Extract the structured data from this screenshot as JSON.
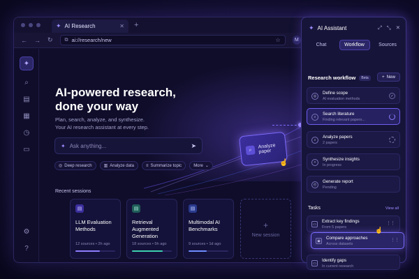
{
  "browser": {
    "tab_title": "AI Research",
    "url": "ai://research/new",
    "profile_initial": "M"
  },
  "hero": {
    "title_line1": "AI-powered research,",
    "title_line2": "done your way",
    "subtitle_line1": "Plan, search, analyze, and synthesize.",
    "subtitle_line2": "Your AI research assistant at every step.",
    "ask_placeholder": "Ask anything...",
    "chips": [
      "Deep research",
      "Analyze data",
      "Summarize topic",
      "More"
    ]
  },
  "floating_card": {
    "label_line1": "Analyze",
    "label_line2": "paper"
  },
  "recent": {
    "title": "Recent sessions",
    "sessions": [
      {
        "title_line1": "LLM Evaluation",
        "title_line2": "Methods",
        "meta": "12 sources • 2h ago",
        "progress": 0.62,
        "color": "#8e7dff"
      },
      {
        "title_line1": "Retrieval Augmented",
        "title_line2": "Generation",
        "meta": "18 sources • 5h ago",
        "progress": 0.78,
        "color": "#3fd1b0"
      },
      {
        "title_line1": "Multimodal AI",
        "title_line2": "Benchmarks",
        "meta": "9 sources • 1d ago",
        "progress": 0.45,
        "color": "#6f8dff"
      }
    ],
    "new_session_label": "New session"
  },
  "assistant": {
    "title": "AI Assistant",
    "tabs": [
      "Chat",
      "Workflow",
      "Sources"
    ],
    "selected_tab": "Workflow",
    "workflow_title": "Research workflow",
    "beta_label": "Beta",
    "new_label": "New",
    "steps": [
      {
        "title": "Define scope",
        "desc": "AI evaluation methods",
        "status": "done"
      },
      {
        "title": "Search literature",
        "desc": "Finding relevant papers...",
        "status": "in-progress"
      },
      {
        "title": "Analyze papers",
        "desc": "2 papers",
        "status": "running"
      },
      {
        "title": "Synthesize insights",
        "desc": "In progress",
        "status": "pending"
      },
      {
        "title": "Generate report",
        "desc": "Pending",
        "status": "pending"
      }
    ],
    "tasks_title": "Tasks",
    "view_all": "View all",
    "tasks": [
      {
        "title": "Extract key findings",
        "desc": "From 5 papers"
      },
      {
        "title": "Compare approaches",
        "desc": "Across datasets"
      },
      {
        "title": "Identify gaps",
        "desc": "In current research"
      }
    ]
  },
  "colors": {
    "accent": "#8e7dff",
    "background": "#0d0b26"
  }
}
